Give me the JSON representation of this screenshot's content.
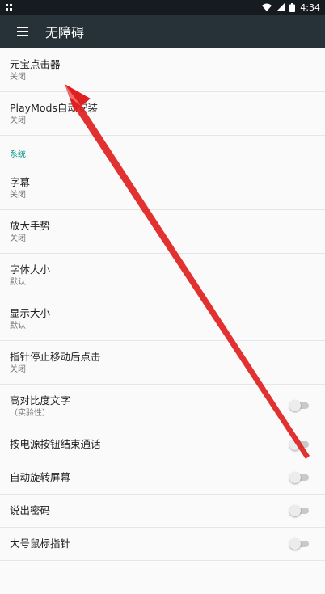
{
  "status_bar": {
    "time": "4:34"
  },
  "app_bar": {
    "title": "无障碍"
  },
  "items_top": [
    {
      "title": "元宝点击器",
      "subtitle": "关闭"
    },
    {
      "title": "PlayMods自动安装",
      "subtitle": "关闭"
    }
  ],
  "section_system": "系统",
  "items_system": [
    {
      "title": "字幕",
      "subtitle": "关闭"
    },
    {
      "title": "放大手势",
      "subtitle": "关闭"
    },
    {
      "title": "字体大小",
      "subtitle": "默认"
    },
    {
      "title": "显示大小",
      "subtitle": "默认"
    },
    {
      "title": "指针停止移动后点击",
      "subtitle": "关闭"
    }
  ],
  "toggle_items": [
    {
      "title": "高对比度文字",
      "subtitle": "（实验性）",
      "checked": false
    },
    {
      "title": "按电源按钮结束通话",
      "checked": false
    },
    {
      "title": "自动旋转屏幕",
      "checked": false
    },
    {
      "title": "说出密码",
      "checked": false
    },
    {
      "title": "大号鼠标指针",
      "checked": false
    }
  ],
  "colors": {
    "appbar": "#263238",
    "statusbar": "#161b20",
    "accent": "#009688",
    "annotation_arrow": "#e02020"
  }
}
